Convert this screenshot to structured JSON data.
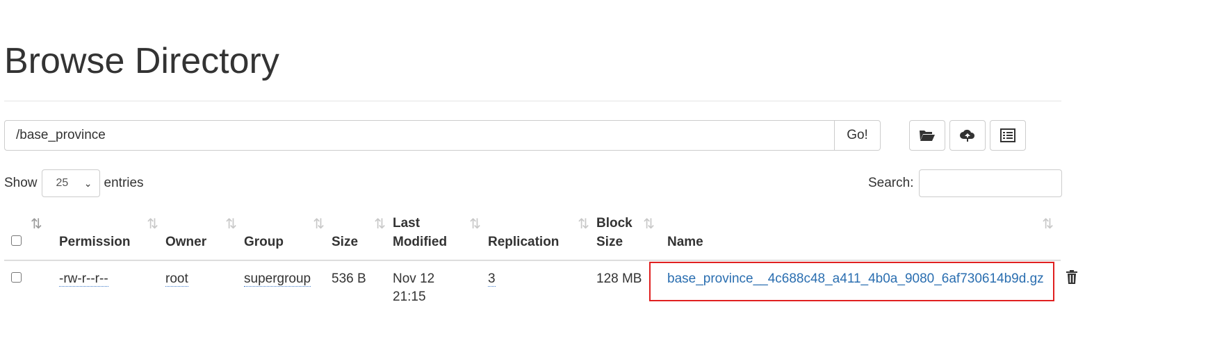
{
  "page": {
    "title": "Browse Directory"
  },
  "path_bar": {
    "value": "/base_province",
    "go_label": "Go!"
  },
  "toolbar": {
    "create_folder_icon": "folder-open-icon",
    "upload_icon": "cloud-upload-icon",
    "list_icon": "list-alt-icon"
  },
  "table_controls": {
    "show_label": "Show",
    "page_size": "25",
    "entries_label": "entries",
    "search_label": "Search:",
    "search_value": ""
  },
  "table": {
    "headers": {
      "permission": "Permission",
      "owner": "Owner",
      "group": "Group",
      "size": "Size",
      "last_modified_1": "Last",
      "last_modified_2": "Modified",
      "replication": "Replication",
      "block_size_1": "Block",
      "block_size_2": "Size",
      "name": "Name"
    },
    "rows": [
      {
        "permission": "-rw-r--r--",
        "owner": "root",
        "group": "supergroup",
        "size": "536 B",
        "last_modified_1": "Nov 12",
        "last_modified_2": "21:15",
        "replication": "3",
        "block_size": "128 MB",
        "name": "base_province__4c688c48_a411_4b0a_9080_6af730614b9d.gz"
      }
    ]
  },
  "colors": {
    "link": "#2a6eb0",
    "highlight": "#e02020"
  }
}
